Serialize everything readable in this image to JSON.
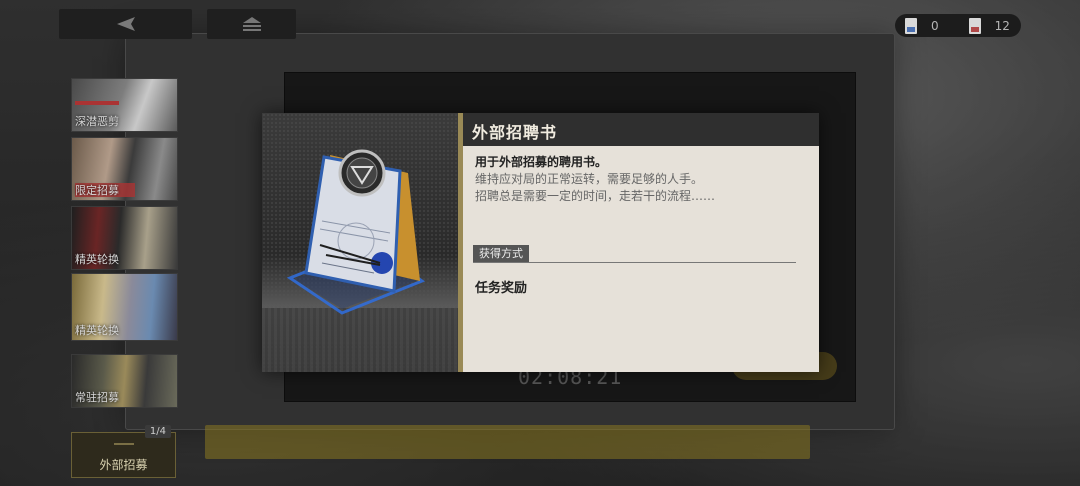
{
  "top_bar": {
    "back_icon": "back-triangle-icon",
    "home_icon": "home-icon",
    "currencies": [
      {
        "icon": "ticket-blue-icon",
        "value": "0"
      },
      {
        "icon": "ticket-red-icon",
        "value": "12"
      }
    ]
  },
  "sidebar": {
    "items": [
      {
        "label": "深潜恶剪"
      },
      {
        "label": "限定招募"
      },
      {
        "label": "精英轮换"
      },
      {
        "label": "精英轮换"
      },
      {
        "label": "常驻招募"
      },
      {
        "label": "外部招募",
        "badge": "1/4",
        "active": true
      }
    ]
  },
  "background": {
    "timer": "02:08:21"
  },
  "dialog": {
    "title": "外部招聘书",
    "description_main": "用于外部招募的聘用书。",
    "description_lines": [
      "维持应对局的正常运转，需要足够的人手。",
      "招聘总是需要一定的时间，走若干的流程……"
    ],
    "obtain_label": "获得方式",
    "obtain_value": "任务奖励",
    "item_icon": "recruitment-letter-icon"
  },
  "colors": {
    "accent_gold": "#9a8a56",
    "panel_bg": "#e6e1d9",
    "header_bg": "#2f2f2f"
  }
}
